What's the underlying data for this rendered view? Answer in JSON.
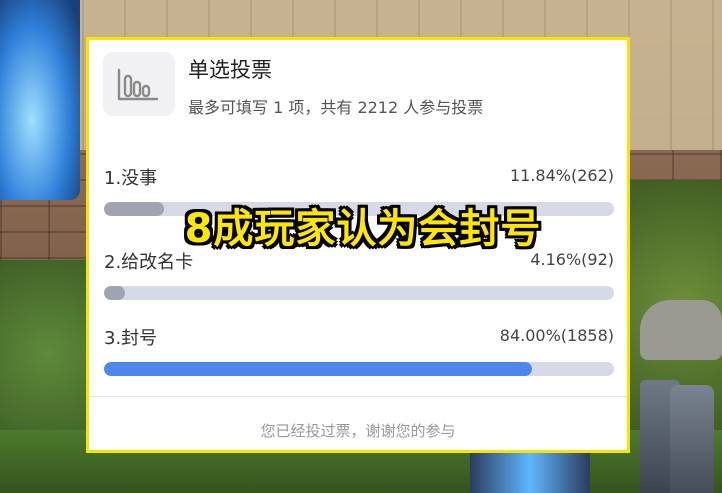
{
  "poll": {
    "title": "单选投票",
    "subtitle": "最多可填写 1 项，共有 2212 人参与投票",
    "icon": "bar-chart-icon",
    "options": [
      {
        "label": "1.没事",
        "stat": "11.84%(262)",
        "percent": 11.84,
        "votes": 262,
        "color": "#a0a4b2"
      },
      {
        "label": "2.给改名卡",
        "stat": "4.16%(92)",
        "percent": 4.16,
        "votes": 92,
        "color": "#a0a4b2"
      },
      {
        "label": "3.封号",
        "stat": "84.00%(1858)",
        "percent": 84.0,
        "votes": 1858,
        "color": "#4f86ee"
      }
    ],
    "footer": "您已经投过票，谢谢您的参与"
  },
  "overlay_caption": "8成玩家认为会封号",
  "colors": {
    "frame": "#f5e500",
    "caption": "#ffe700",
    "track": "#d6dae6"
  }
}
